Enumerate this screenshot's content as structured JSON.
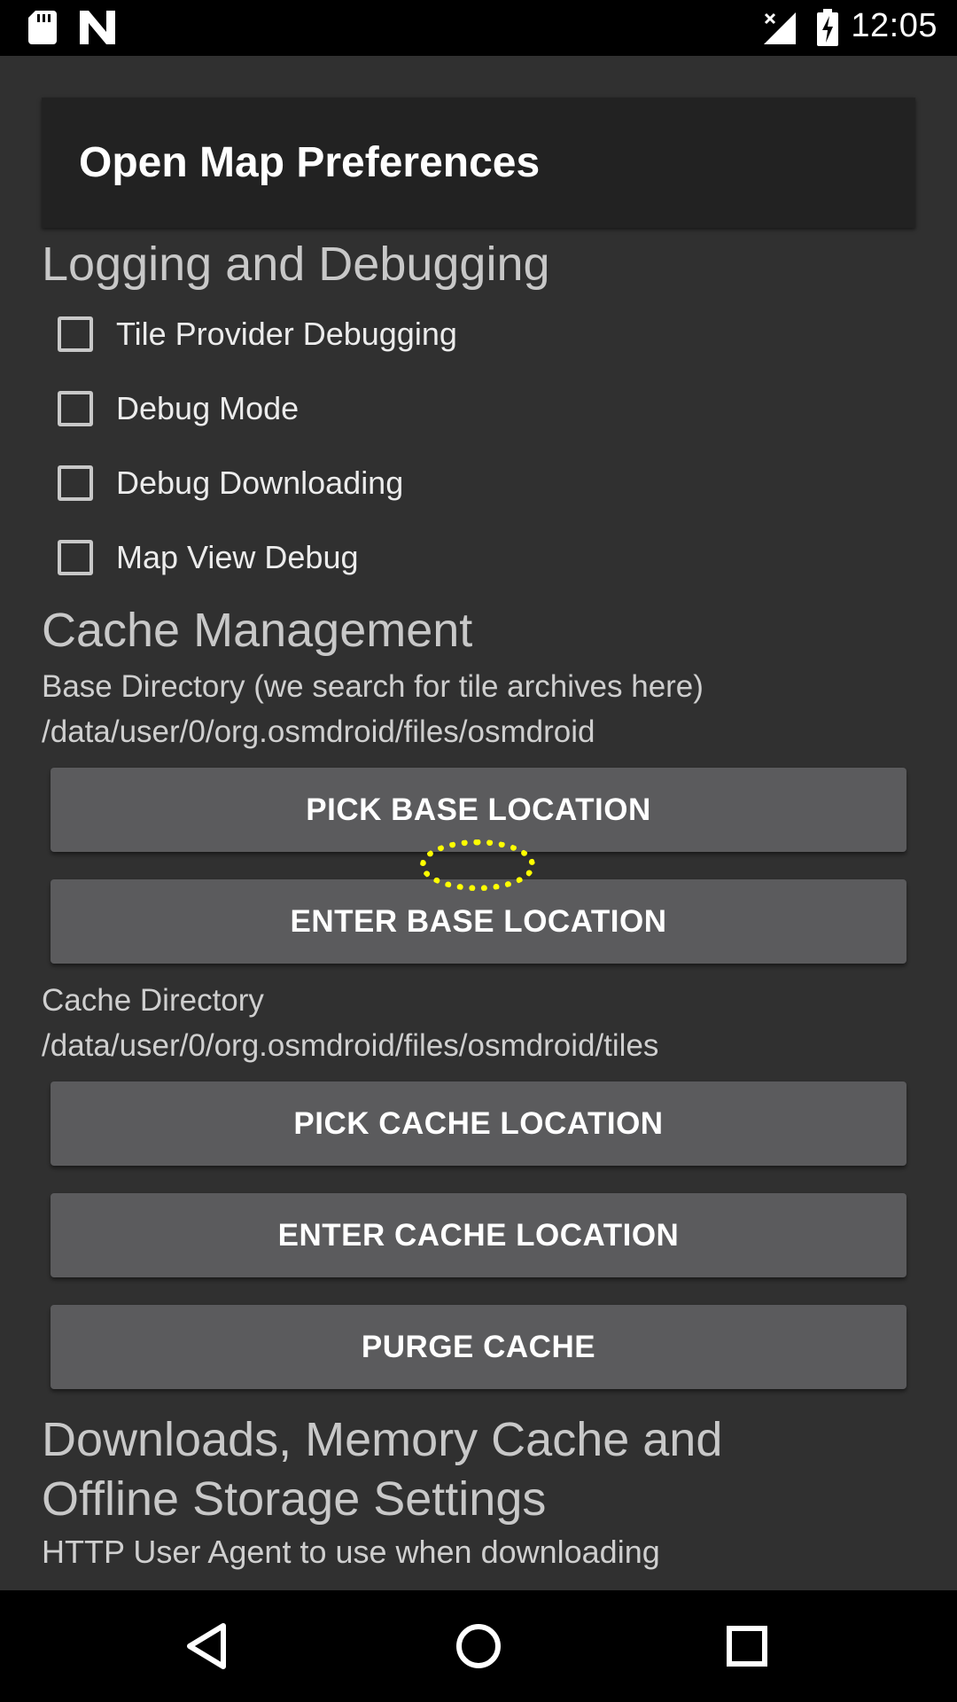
{
  "status_bar": {
    "time": "12:05",
    "icons": [
      "sd-card-icon",
      "n-logo-icon",
      "signal-no-service-icon",
      "battery-charging-icon"
    ]
  },
  "title": "Open Map Preferences",
  "sections": {
    "logging": {
      "header": "Logging and Debugging",
      "checkboxes": [
        {
          "label": "Tile Provider Debugging",
          "checked": false
        },
        {
          "label": "Debug Mode",
          "checked": false
        },
        {
          "label": "Debug Downloading",
          "checked": false
        },
        {
          "label": "Map View Debug",
          "checked": false
        }
      ]
    },
    "cache": {
      "header": "Cache Management",
      "base_dir_label": "Base Directory (we search for tile archives here)",
      "base_dir_value": "/data/user/0/org.osmdroid/files/osmdroid",
      "pick_base_button": "PICK BASE LOCATION",
      "enter_base_button": "ENTER BASE LOCATION",
      "cache_dir_label": "Cache Directory",
      "cache_dir_value": "/data/user/0/org.osmdroid/files/osmdroid/tiles",
      "pick_cache_button": "PICK CACHE LOCATION",
      "enter_cache_button": "ENTER CACHE LOCATION",
      "purge_cache_button": "PURGE CACHE"
    },
    "downloads": {
      "header_line1": "Downloads, Memory Cache and",
      "header_line2": "Offline Storage Settings",
      "partial_text": "HTTP User Agent to use when downloading"
    }
  },
  "nav_bar": {
    "icons": [
      "back-icon",
      "home-icon",
      "recents-icon"
    ]
  },
  "colors": {
    "background": "#303030",
    "title_card": "#222222",
    "button": "#5b5b5d",
    "tap_indicator": "#ffff00"
  }
}
